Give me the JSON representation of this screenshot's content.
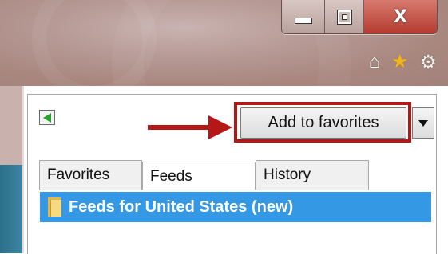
{
  "window": {
    "minimize_icon": "minimize-icon",
    "maximize_icon": "restore-icon",
    "close_label": "X"
  },
  "toolbar": {
    "icons": [
      "home-icon",
      "star-icon",
      "gear-icon"
    ]
  },
  "favorites_center": {
    "pin_icon": "pin-arrow-icon",
    "add_button_label": "Add to favorites",
    "dropdown_icon": "chevron-down-icon",
    "tabs": [
      {
        "label": "Favorites",
        "selected": false
      },
      {
        "label": "Feeds",
        "selected": true
      },
      {
        "label": "History",
        "selected": false
      }
    ],
    "feeds": [
      {
        "label": "Feeds for United States (new)",
        "selected": true
      }
    ]
  },
  "colors": {
    "highlight": "#b51616",
    "selection": "#3598e4",
    "star": "#f2b61e"
  }
}
